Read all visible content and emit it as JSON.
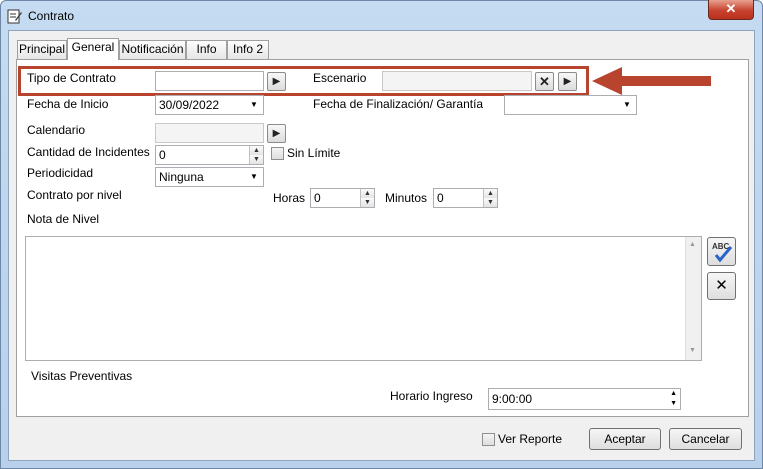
{
  "window": {
    "title": "Contrato",
    "close_label": "✕"
  },
  "tabs": [
    {
      "label": "Principal"
    },
    {
      "label": "General"
    },
    {
      "label": "Notificación"
    },
    {
      "label": "Info"
    },
    {
      "label": "Info 2"
    }
  ],
  "form": {
    "tipo_contrato_label": "Tipo de Contrato",
    "tipo_contrato_value": "",
    "escenario_label": "Escenario",
    "escenario_value": "",
    "fecha_inicio_label": "Fecha de Inicio",
    "fecha_inicio_value": "30/09/2022",
    "fecha_fin_label": "Fecha de Finalización/ Garantía",
    "fecha_fin_value": "",
    "calendario_label": "Calendario",
    "calendario_value": "",
    "cantidad_label": "Cantidad de Incidentes",
    "cantidad_value": "0",
    "sin_limite_label": "Sin Límite",
    "periodicidad_label": "Periodicidad",
    "periodicidad_value": "Ninguna",
    "contrato_nivel_label": "Contrato por nivel",
    "horas_label": "Horas",
    "horas_value": "0",
    "minutos_label": "Minutos",
    "minutos_value": "0",
    "nota_nivel_label": "Nota de Nivel",
    "nota_nivel_value": "",
    "visitas_label": "Visitas Preventivas",
    "horario_label": "Horario Ingreso",
    "horario_value": "9:00:00",
    "spell_label": "ABC"
  },
  "footer": {
    "ver_reporte_label": "Ver Reporte",
    "aceptar_label": "Aceptar",
    "cancelar_label": "Cancelar"
  },
  "colors": {
    "highlight": "#b8442e",
    "window_frame": "#b8d0ea"
  }
}
